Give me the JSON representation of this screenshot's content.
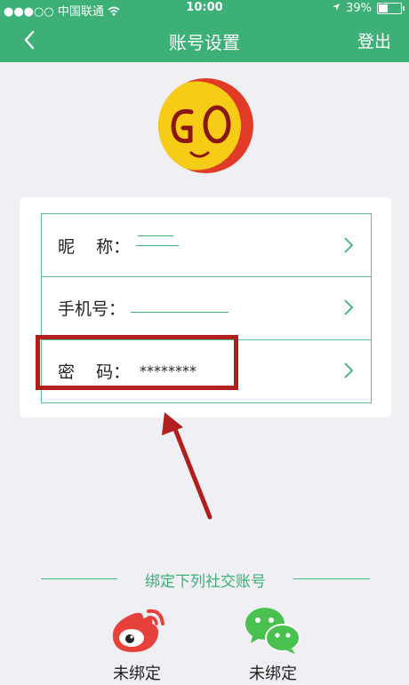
{
  "status_bar": {
    "signal": "●●●○○",
    "carrier": "中国联通",
    "wifi_icon": "wifi-icon",
    "time": "10:00",
    "location_icon": "location-arrow-icon",
    "battery": "39%"
  },
  "nav": {
    "back_icon": "chevron-left-icon",
    "title": "账号设置",
    "logout_label": "登出"
  },
  "avatar": {
    "logo_text": "GO"
  },
  "settings": [
    {
      "label": "昵    称：",
      "value": ""
    },
    {
      "label": "手机号：",
      "value": ""
    },
    {
      "label": "密    码：",
      "value": "********"
    }
  ],
  "social": {
    "title": "绑定下列社交账号",
    "items": [
      {
        "icon": "weibo-icon",
        "status": "未绑定"
      },
      {
        "icon": "wechat-icon",
        "status": "未绑定"
      }
    ]
  },
  "colors": {
    "brand_green": "#3cb077",
    "highlight_red": "#b01e1e",
    "background": "#efeff4"
  }
}
